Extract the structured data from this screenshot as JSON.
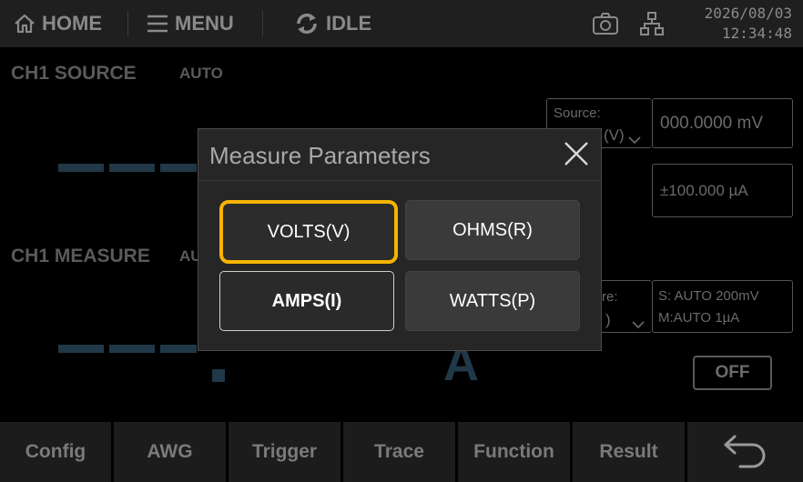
{
  "topbar": {
    "home_label": "HOME",
    "menu_label": "MENU",
    "status_label": "IDLE",
    "date": "2026/08/03",
    "time": "12:34:48"
  },
  "source_section": {
    "title": "CH1 SOURCE",
    "mode": "AUTO",
    "source_label": "Source:",
    "source_value": "(V)",
    "level_value": "000.0000 mV",
    "limit_value": "±100.000 µA"
  },
  "measure_section": {
    "title": "CH1 MEASURE",
    "mode": "AU",
    "range_label": "re:",
    "range_value": ")",
    "range_source": "S:  AUTO 200mV",
    "range_measure": "M:AUTO 1µA",
    "unit": "A",
    "output_label": "OFF"
  },
  "dialog": {
    "title": "Measure Parameters",
    "options": [
      {
        "label": "VOLTS(V)",
        "state": "focused"
      },
      {
        "label": "OHMS(R)",
        "state": "normal"
      },
      {
        "label": "AMPS(I)",
        "state": "selected"
      },
      {
        "label": "WATTS(P)",
        "state": "normal"
      }
    ]
  },
  "bottombar": {
    "items": [
      "Config",
      "AWG",
      "Trigger",
      "Trace",
      "Function",
      "Result"
    ]
  },
  "colors": {
    "focus_ring": "#f5b400",
    "dialog_bg": "#262626",
    "dim_value": "#203848"
  },
  "icons": [
    "home-icon",
    "menu-icon",
    "refresh-icon",
    "camera-icon",
    "network-icon",
    "close-icon",
    "back-icon",
    "chevron-down-icon"
  ]
}
